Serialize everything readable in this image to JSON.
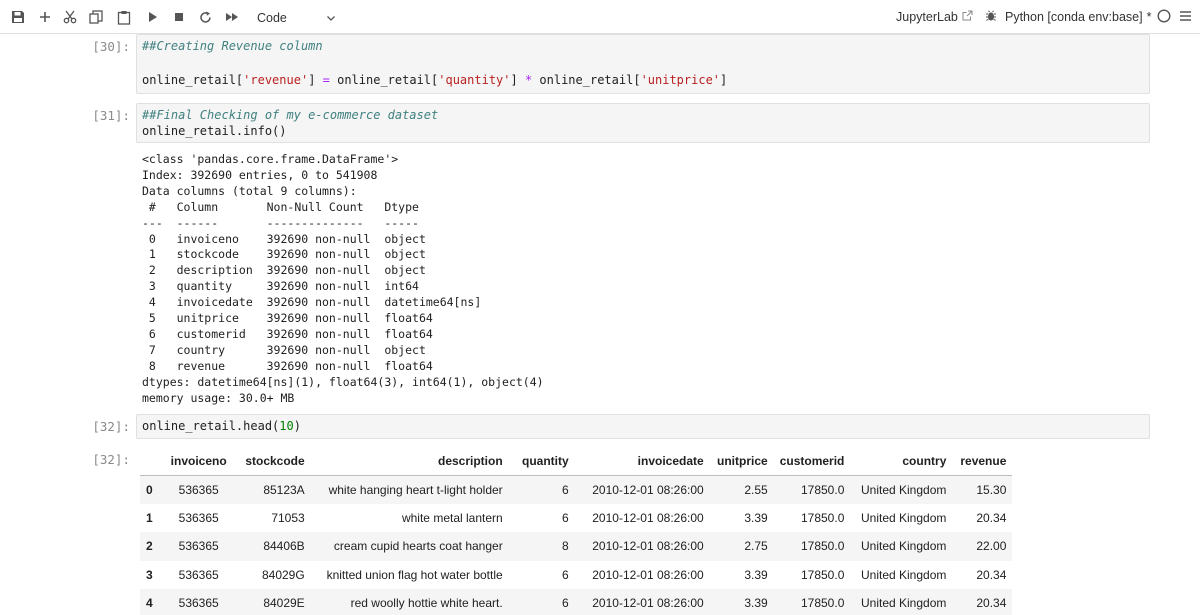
{
  "toolbar": {
    "icons": [
      "save-icon",
      "add-cell-icon",
      "cut-icon",
      "copy-icon",
      "paste-icon",
      "run-icon",
      "stop-icon",
      "restart-icon",
      "fast-forward-icon"
    ],
    "cell_type": "Code",
    "jupyterlab_label": "JupyterLab",
    "kernel_label": "Python [conda env:base]",
    "kernel_status_marker": "*"
  },
  "cells": {
    "c30": {
      "prompt": "[30]:",
      "comment": "##Creating Revenue column",
      "code_a": "online_retail[",
      "str_a": "'revenue'",
      "code_b": "] ",
      "op_eq": "=",
      "code_c": " online_retail[",
      "str_b": "'quantity'",
      "code_d": "] ",
      "op_mul": "*",
      "code_e": " online_retail[",
      "str_c": "'unitprice'",
      "code_f": "]"
    },
    "c31": {
      "prompt": "[31]:",
      "comment": "##Final Checking of my e-commerce dataset",
      "code": "online_retail.info()",
      "output_lines": [
        "<class 'pandas.core.frame.DataFrame'>",
        "Index: 392690 entries, 0 to 541908",
        "Data columns (total 9 columns):",
        " #   Column       Non-Null Count   Dtype",
        "---  ------       --------------   -----",
        " 0   invoiceno    392690 non-null  object",
        " 1   stockcode    392690 non-null  object",
        " 2   description  392690 non-null  object",
        " 3   quantity     392690 non-null  int64",
        " 4   invoicedate  392690 non-null  datetime64[ns]",
        " 5   unitprice    392690 non-null  float64",
        " 6   customerid   392690 non-null  float64",
        " 7   country      392690 non-null  object",
        " 8   revenue      392690 non-null  float64",
        "dtypes: datetime64[ns](1), float64(3), int64(1), object(4)",
        "memory usage: 30.0+ MB"
      ]
    },
    "c32": {
      "prompt": "[32]:",
      "out_prompt": "[32]:",
      "code_a": "online_retail.head(",
      "num": "10",
      "code_b": ")"
    }
  },
  "dataframe": {
    "columns": [
      "invoiceno",
      "stockcode",
      "description",
      "quantity",
      "invoicedate",
      "unitprice",
      "customerid",
      "country",
      "revenue"
    ],
    "rows": [
      {
        "index": "0",
        "values": [
          "536365",
          "85123A",
          "white hanging heart t-light holder",
          "6",
          "2010-12-01 08:26:00",
          "2.55",
          "17850.0",
          "United Kingdom",
          "15.30"
        ]
      },
      {
        "index": "1",
        "values": [
          "536365",
          "71053",
          "white metal lantern",
          "6",
          "2010-12-01 08:26:00",
          "3.39",
          "17850.0",
          "United Kingdom",
          "20.34"
        ]
      },
      {
        "index": "2",
        "values": [
          "536365",
          "84406B",
          "cream cupid hearts coat hanger",
          "8",
          "2010-12-01 08:26:00",
          "2.75",
          "17850.0",
          "United Kingdom",
          "22.00"
        ]
      },
      {
        "index": "3",
        "values": [
          "536365",
          "84029G",
          "knitted union flag hot water bottle",
          "6",
          "2010-12-01 08:26:00",
          "3.39",
          "17850.0",
          "United Kingdom",
          "20.34"
        ]
      },
      {
        "index": "4",
        "values": [
          "536365",
          "84029E",
          "red woolly hottie white heart.",
          "6",
          "2010-12-01 08:26:00",
          "3.39",
          "17850.0",
          "United Kingdom",
          "20.34"
        ]
      }
    ]
  }
}
